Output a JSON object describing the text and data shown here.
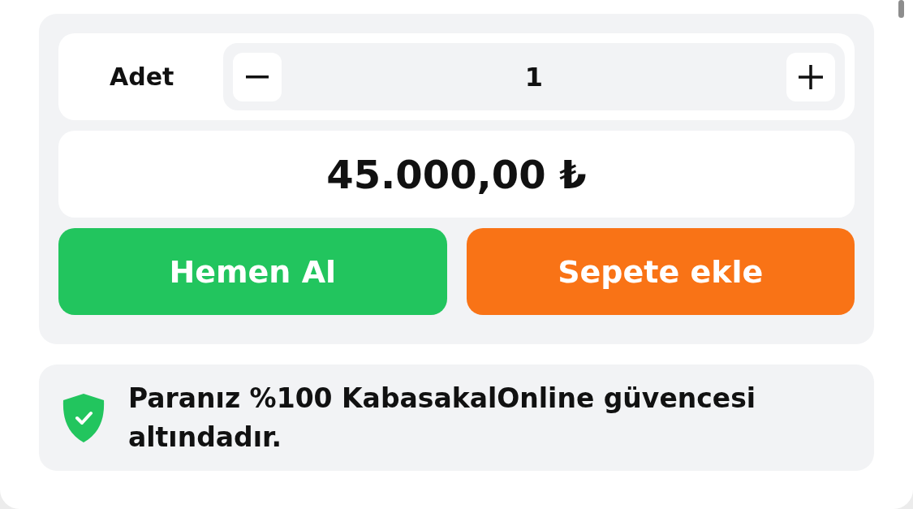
{
  "quantity": {
    "label": "Adet",
    "value": "1"
  },
  "price": "45.000,00 ₺",
  "buttons": [
    {
      "kind": "buy",
      "label": "Hemen Al"
    },
    {
      "kind": "cart",
      "label": "Sepete ekle"
    }
  ],
  "guarantee": "Paranız %100 KabasakalOnline güvencesi altındadır."
}
